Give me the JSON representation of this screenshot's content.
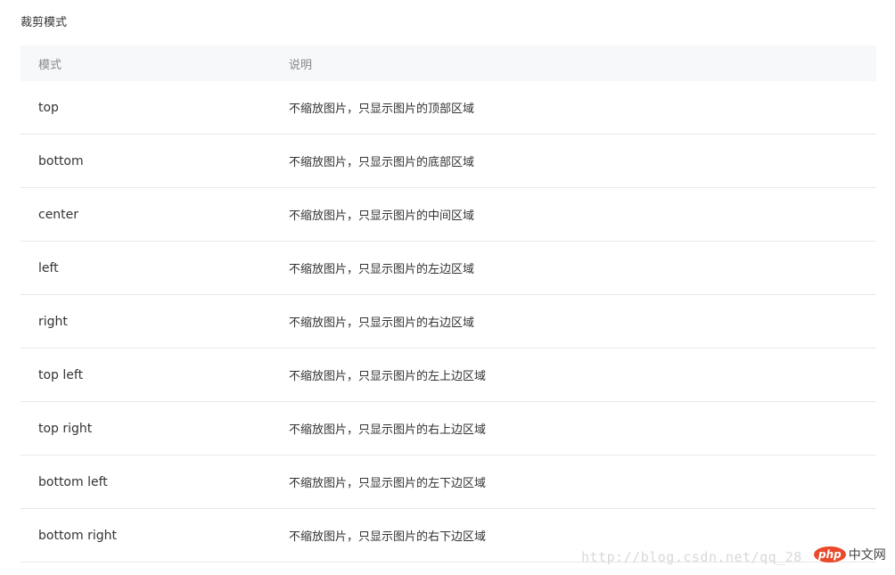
{
  "section_title": "裁剪模式",
  "table": {
    "headers": {
      "mode": "模式",
      "desc": "说明"
    },
    "rows": [
      {
        "mode": "top",
        "desc": "不缩放图片，只显示图片的顶部区域"
      },
      {
        "mode": "bottom",
        "desc": "不缩放图片，只显示图片的底部区域"
      },
      {
        "mode": "center",
        "desc": "不缩放图片，只显示图片的中间区域"
      },
      {
        "mode": "left",
        "desc": "不缩放图片，只显示图片的左边区域"
      },
      {
        "mode": "right",
        "desc": "不缩放图片，只显示图片的右边区域"
      },
      {
        "mode": "top left",
        "desc": "不缩放图片，只显示图片的左上边区域"
      },
      {
        "mode": "top right",
        "desc": "不缩放图片，只显示图片的右上边区域"
      },
      {
        "mode": "bottom left",
        "desc": "不缩放图片，只显示图片的左下边区域"
      },
      {
        "mode": "bottom right",
        "desc": "不缩放图片，只显示图片的右下边区域"
      }
    ]
  },
  "watermark": "http://blog.csdn.net/qq_28",
  "logo": {
    "php": "php",
    "cn": "中文网"
  }
}
